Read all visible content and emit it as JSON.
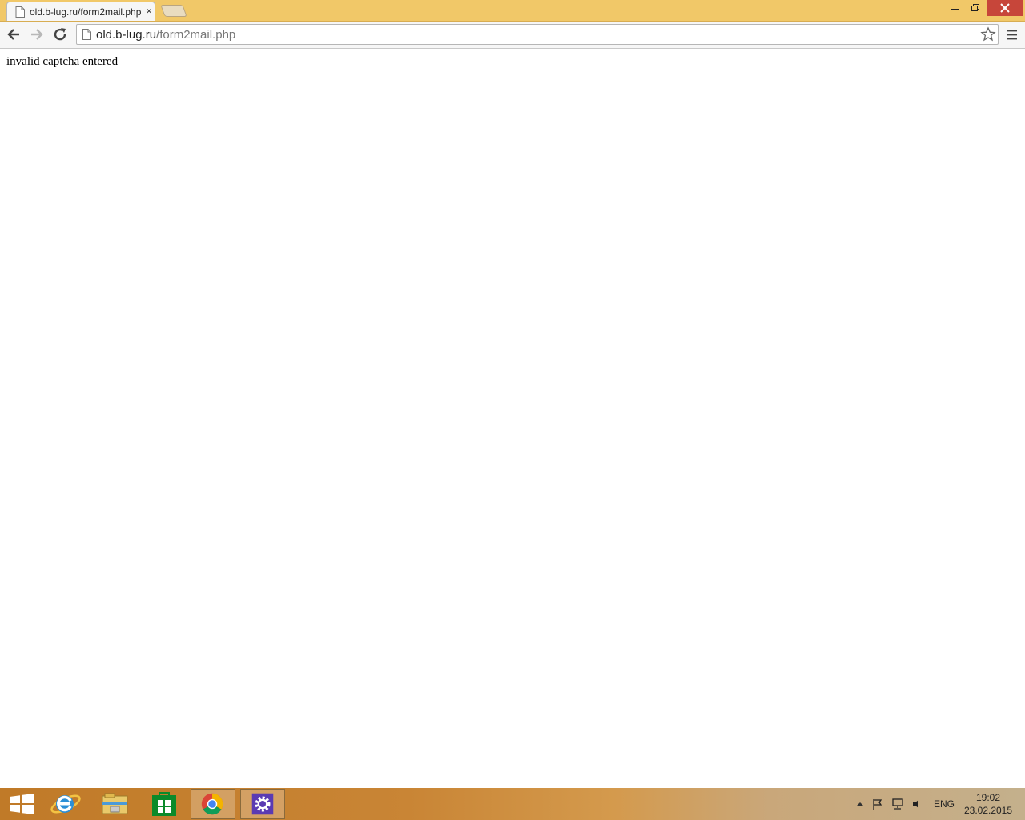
{
  "browser": {
    "tab": {
      "title": "old.b-lug.ru/form2mail.php",
      "close_glyph": "×"
    },
    "window_controls": {
      "minimize": "–",
      "maximize": "❐",
      "close": "✕"
    },
    "toolbar": {
      "back_icon": "back-arrow-icon",
      "forward_icon": "forward-arrow-icon",
      "reload_icon": "reload-icon",
      "url_host": "old.b-lug.ru",
      "url_path": "/form2mail.php",
      "star_icon": "bookmark-star-icon",
      "menu_icon": "hamburger-menu-icon"
    },
    "colors": {
      "tabstrip": "#f1c868",
      "close_button": "#c7463a"
    }
  },
  "page": {
    "message": "invalid captcha entered"
  },
  "taskbar": {
    "apps": [
      "start-icon",
      "internet-explorer-icon",
      "file-explorer-icon",
      "store-icon",
      "chrome-icon",
      "settings-icon"
    ],
    "tray": {
      "language": "ENG",
      "time": "19:02",
      "date": "23.02.2015"
    }
  }
}
